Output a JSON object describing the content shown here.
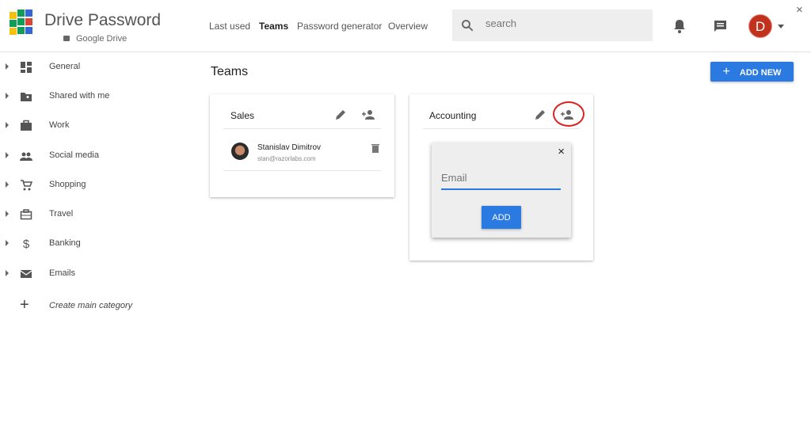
{
  "header": {
    "brand": "Drive Password",
    "sub": "Google Drive",
    "nav": [
      "Last used",
      "Teams",
      "Password generator",
      "Overview"
    ],
    "active_nav": "Teams",
    "search_placeholder": "search",
    "avatar_letter": "D",
    "close": "×"
  },
  "sidebar": {
    "items": [
      {
        "label": "General",
        "icon": "dashboard-icon"
      },
      {
        "label": "Shared with me",
        "icon": "shared-folder-icon"
      },
      {
        "label": "Work",
        "icon": "briefcase-icon"
      },
      {
        "label": "Social media",
        "icon": "people-icon"
      },
      {
        "label": "Shopping",
        "icon": "cart-icon"
      },
      {
        "label": "Travel",
        "icon": "suitcase-icon"
      },
      {
        "label": "Banking",
        "icon": "dollar-icon"
      },
      {
        "label": "Emails",
        "icon": "mail-icon"
      }
    ],
    "create": "Create main category"
  },
  "main": {
    "title": "Teams",
    "add_new": "ADD NEW",
    "teams": [
      {
        "name": "Sales",
        "members": [
          {
            "name": "Stanislav Dimitrov",
            "email": "stan@razorlabs.com"
          }
        ]
      },
      {
        "name": "Accounting",
        "members": []
      }
    ],
    "popup": {
      "placeholder": "Email",
      "add": "ADD"
    }
  },
  "colors": {
    "accent": "#2a7ae2",
    "highlight": "#e02020",
    "avatar": "#c0321c"
  }
}
